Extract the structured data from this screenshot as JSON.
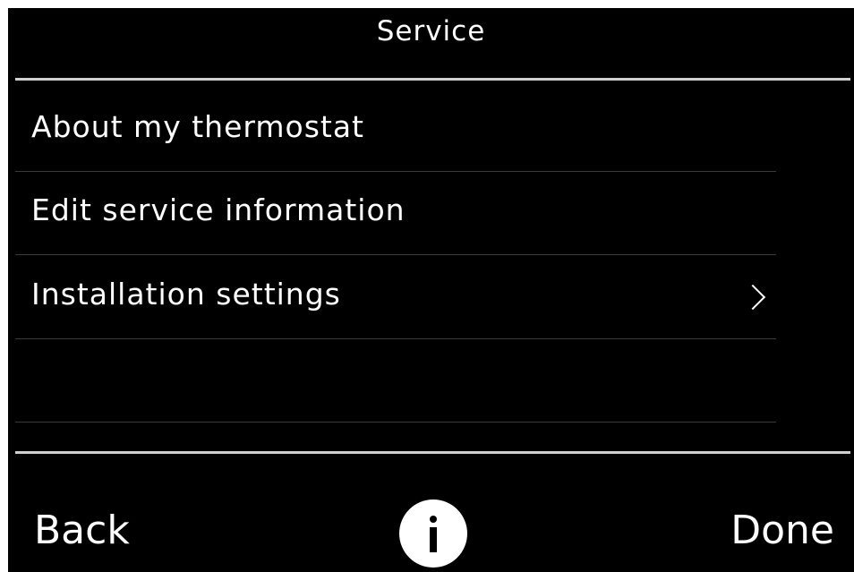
{
  "header": {
    "title": "Service"
  },
  "menu": {
    "items": [
      {
        "label": "About my thermostat",
        "has_chevron": false
      },
      {
        "label": "Edit service information",
        "has_chevron": false
      },
      {
        "label": "Installation settings",
        "has_chevron": true
      },
      {
        "label": "",
        "has_chevron": false
      }
    ]
  },
  "footer": {
    "back_label": "Back",
    "info_icon": "info-icon",
    "done_label": "Done"
  },
  "colors": {
    "background": "#000000",
    "text": "#ffffff",
    "divider": "#cfcfcf",
    "item_divider": "#3a3a3a"
  }
}
